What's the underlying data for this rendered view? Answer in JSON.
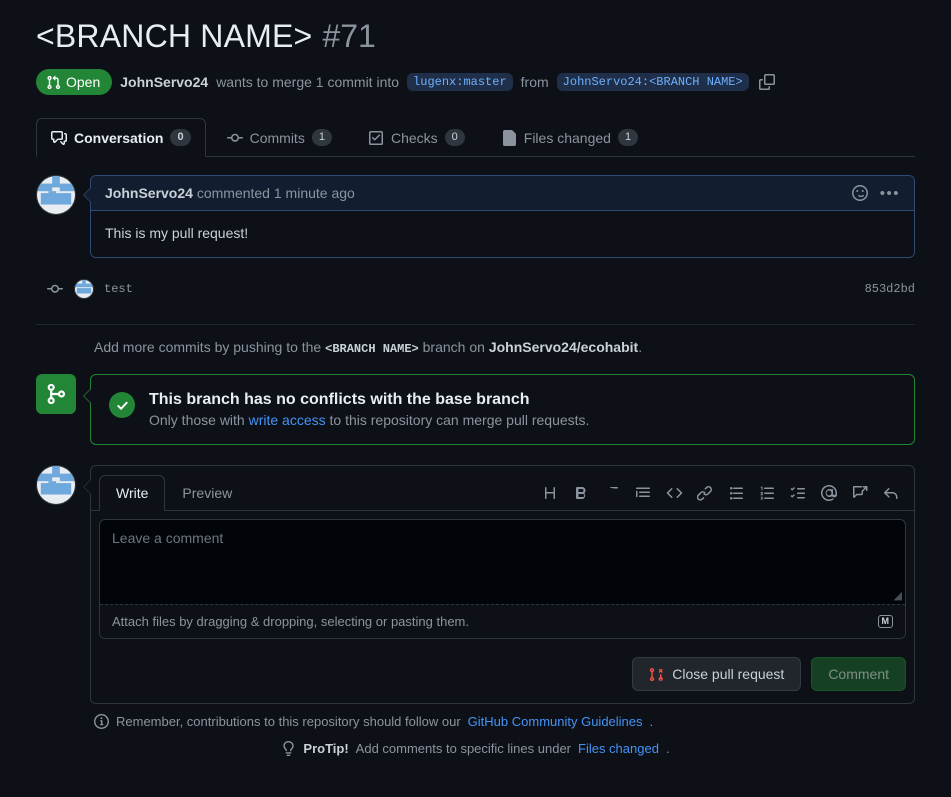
{
  "header": {
    "title": "<BRANCH NAME>",
    "number": "#71",
    "state": "Open",
    "state_color": "#238636",
    "author": "JohnServo24",
    "merge_text_1": "wants to merge 1 commit into",
    "base_branch": "lugenx:master",
    "from_word": "from",
    "head_branch": "JohnServo24:<BRANCH NAME>",
    "copy_icon": "copy-icon"
  },
  "tabs": [
    {
      "label": "Conversation",
      "count": "0",
      "icon": "comment-icon",
      "active": true
    },
    {
      "label": "Commits",
      "count": "1",
      "icon": "commit-icon",
      "active": false
    },
    {
      "label": "Checks",
      "count": "0",
      "icon": "checklist-icon",
      "active": false
    },
    {
      "label": "Files changed",
      "count": "1",
      "icon": "file-diff-icon",
      "active": false
    }
  ],
  "comment": {
    "author": "JohnServo24",
    "action": "commented",
    "time": "1 minute ago",
    "body": "This is my pull request!",
    "reaction_icon": "smiley-icon",
    "menu_icon": "kebab-icon"
  },
  "commit": {
    "message": "test",
    "sha": "853d2bd"
  },
  "push_note": {
    "prefix": "Add more commits by pushing to the",
    "branch": "<BRANCH NAME>",
    "middle": "branch on",
    "repo": "JohnServo24/ecohabit",
    "suffix": "."
  },
  "merge_status": {
    "icon": "merge-icon",
    "check_icon": "check-icon",
    "title": "This branch has no conflicts with the base branch",
    "sub_prefix": "Only those with",
    "sub_link": "write access",
    "sub_suffix": "to this repository can merge pull requests.",
    "accent_color": "#238636"
  },
  "editor": {
    "tabs": [
      {
        "label": "Write",
        "active": true
      },
      {
        "label": "Preview",
        "active": false
      }
    ],
    "toolbar": [
      {
        "name": "heading-icon",
        "glyph": "H"
      },
      {
        "name": "bold-icon",
        "glyph": "B"
      },
      {
        "name": "italic-icon",
        "glyph": "I"
      },
      {
        "name": "quote-icon",
        "glyph": ""
      },
      {
        "name": "code-icon",
        "glyph": "<>"
      },
      {
        "name": "link-icon",
        "glyph": ""
      },
      {
        "name": "unordered-list-icon",
        "glyph": ""
      },
      {
        "name": "ordered-list-icon",
        "glyph": ""
      },
      {
        "name": "task-list-icon",
        "glyph": ""
      },
      {
        "name": "mention-icon",
        "glyph": "@"
      },
      {
        "name": "saved-reply-icon",
        "glyph": ""
      },
      {
        "name": "reply-icon",
        "glyph": ""
      }
    ],
    "placeholder": "Leave a comment",
    "attach_text": "Attach files by dragging & dropping, selecting or pasting them.",
    "markdown_badge": "M",
    "close_button": "Close pull request",
    "close_icon": "pull-request-closed-icon",
    "comment_button": "Comment"
  },
  "footer": {
    "info_icon": "info-icon",
    "remember_prefix": "Remember, contributions to this repository should follow our",
    "remember_link": "GitHub Community Guidelines",
    "remember_suffix": ".",
    "protip_icon": "lightbulb-icon",
    "protip_label": "ProTip!",
    "protip_text": "Add comments to specific lines under",
    "protip_link": "Files changed",
    "protip_suffix": "."
  }
}
